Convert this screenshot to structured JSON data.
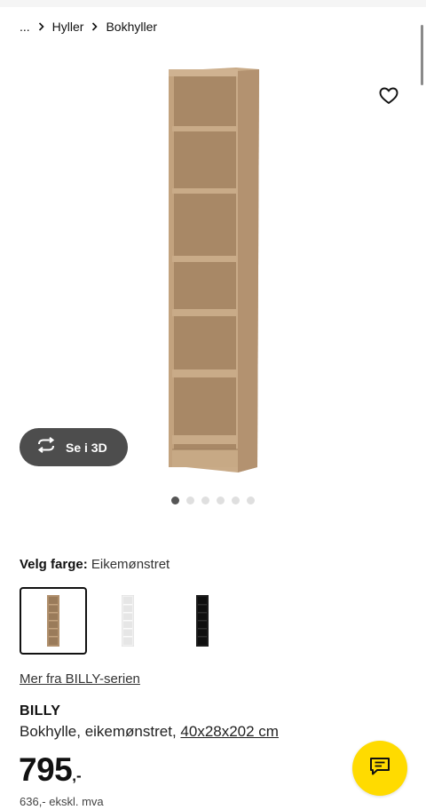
{
  "breadcrumb": {
    "ellipsis": "...",
    "items": [
      {
        "label": "Hyller"
      },
      {
        "label": "Bokhyller"
      }
    ]
  },
  "gallery": {
    "see3d_label": "Se i 3D",
    "dot_count": 6,
    "active_dot": 1
  },
  "color": {
    "label": "Velg farge:",
    "value": "Eikemønstret",
    "options": [
      {
        "name": "eikemønstret",
        "selected": true
      },
      {
        "name": "hvit",
        "selected": false
      },
      {
        "name": "svart",
        "selected": false
      }
    ]
  },
  "series_link": "Mer fra BILLY-serien",
  "product": {
    "name": "BILLY",
    "description": "Bokhylle, eikemønstret, ",
    "size": "40x28x202 cm"
  },
  "price": {
    "main": "795",
    "suffix": ",-",
    "excl_vat": "636,- ekskl. mva"
  },
  "colors": {
    "accent_yellow": "#ffdb00",
    "button_dark": "#4d4d4d"
  }
}
